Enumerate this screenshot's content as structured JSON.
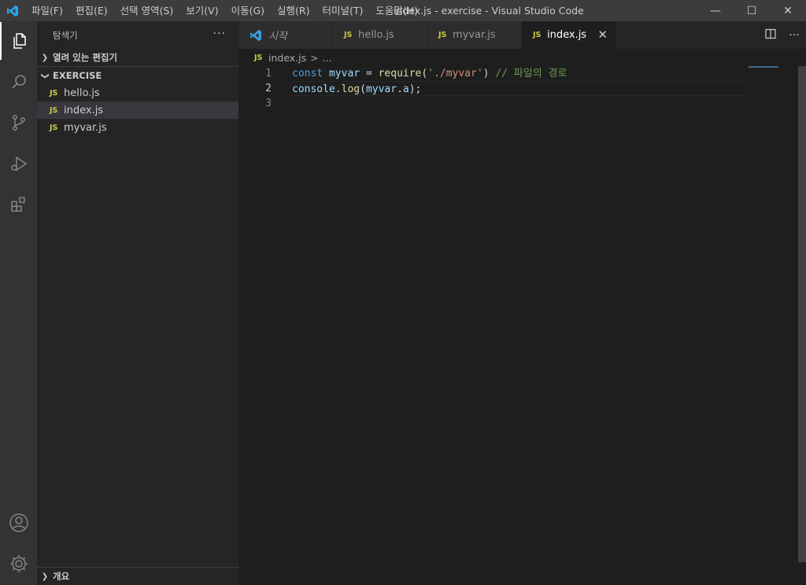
{
  "window": {
    "title": "index.js - exercise - Visual Studio Code",
    "menus": [
      "파일(F)",
      "편집(E)",
      "선택 영역(S)",
      "보기(V)",
      "이동(G)",
      "실행(R)",
      "터미널(T)",
      "도움말(H)"
    ],
    "controls": {
      "minimize": "—",
      "maximize": "☐",
      "close": "✕"
    }
  },
  "activity_bar": {
    "icons": [
      "explorer-icon",
      "search-icon",
      "source-control-icon",
      "run-debug-icon",
      "extensions-icon",
      "account-icon",
      "settings-gear-icon"
    ]
  },
  "sidebar": {
    "title": "탐색기",
    "more": "···",
    "open_editors": "열려 있는 편집기",
    "folder": "EXERCISE",
    "files": [
      {
        "badge": "JS",
        "name": "hello.js"
      },
      {
        "badge": "JS",
        "name": "index.js"
      },
      {
        "badge": "JS",
        "name": "myvar.js"
      }
    ],
    "outline": "개요"
  },
  "tabs": [
    {
      "label": "시작"
    },
    {
      "badge": "JS",
      "label": "hello.js"
    },
    {
      "badge": "JS",
      "label": "myvar.js"
    },
    {
      "badge": "JS",
      "label": "index.js",
      "close": "✕"
    }
  ],
  "breadcrumb": {
    "badge": "JS",
    "file": "index.js",
    "sep": ">",
    "more": "..."
  },
  "code": {
    "line_numbers": [
      "1",
      "2",
      "3"
    ],
    "line1": {
      "kw": "const",
      "var": "myvar",
      "op": " = ",
      "fn": "require",
      "p1": "(",
      "str": "'./myvar'",
      "p2": ")",
      "cmt": " // 파일의 경로"
    },
    "line2": {
      "obj": "console",
      "dot": ".",
      "fn": "log",
      "p1": "(",
      "var": "myvar",
      "dot2": ".",
      "prop": "a",
      "end": ");"
    }
  },
  "colors": {
    "accent": "#007acc",
    "js_badge": "#cbcb41",
    "keyword": "#569cd6",
    "variable": "#9cdcfe",
    "function": "#dcdcaa",
    "string": "#ce9178",
    "comment": "#6a9955"
  }
}
